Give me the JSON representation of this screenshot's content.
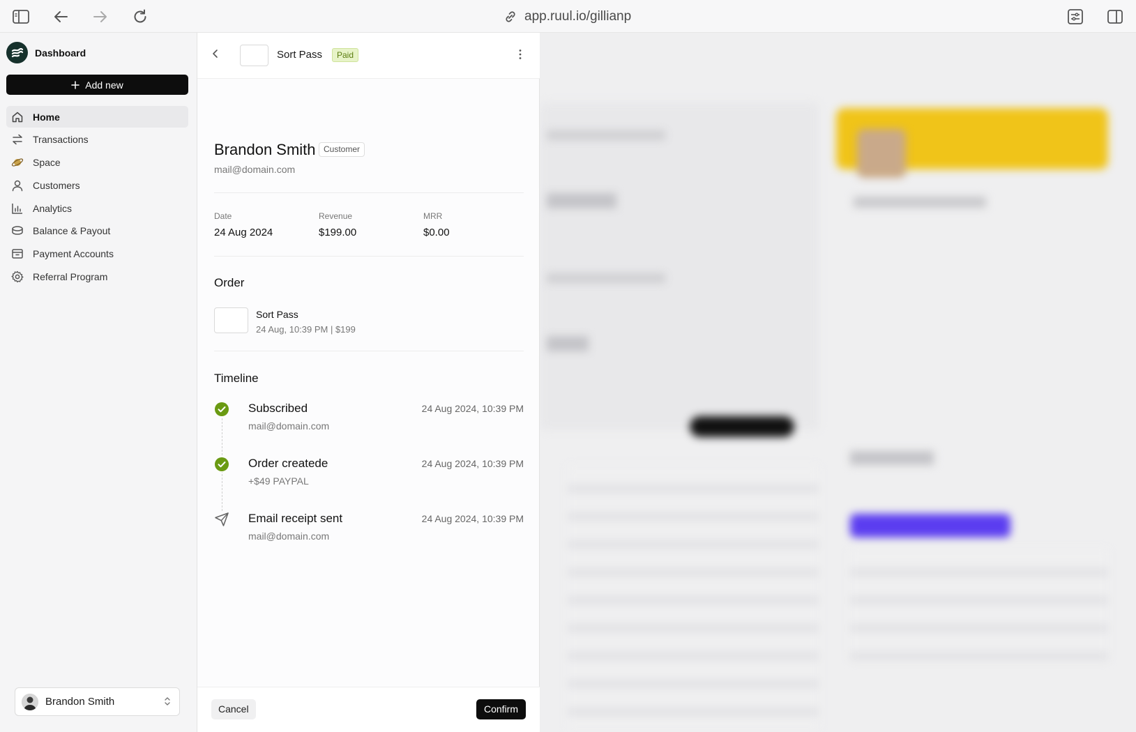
{
  "browser": {
    "url": "app.ruul.io/gillianp",
    "icons": [
      "sidebar-toggle-icon",
      "back-arrow-icon",
      "forward-arrow-icon",
      "reload-icon",
      "link-icon",
      "settings-sliders-icon",
      "split-view-icon"
    ]
  },
  "sidebar": {
    "brand": "Dashboard",
    "add_new": "Add new",
    "items": [
      {
        "label": "Home",
        "icon": "home-icon",
        "active": true
      },
      {
        "label": "Transactions",
        "icon": "arrows-swap-icon"
      },
      {
        "label": "Space",
        "icon": "planet-icon"
      },
      {
        "label": "Customers",
        "icon": "user-icon"
      },
      {
        "label": "Analytics",
        "icon": "bar-chart-icon"
      },
      {
        "label": "Balance & Payout",
        "icon": "coins-icon"
      },
      {
        "label": "Payment Accounts",
        "icon": "archive-icon"
      },
      {
        "label": "Referral Program",
        "icon": "gear-icon"
      }
    ],
    "user": "Brandon Smith"
  },
  "panel": {
    "product": "Sort Pass",
    "status": "Paid",
    "customer_name": "Brandon Smith",
    "customer_tag": "Customer",
    "customer_email": "mail@domain.com",
    "stats": [
      {
        "label": "Date",
        "value": "24 Aug 2024"
      },
      {
        "label": "Revenue",
        "value": "$199.00"
      },
      {
        "label": "MRR",
        "value": "$0.00"
      }
    ],
    "order_title": "Order",
    "order": {
      "name": "Sort Pass",
      "meta": "24 Aug, 10:39 PM | $199"
    },
    "timeline_title": "Timeline",
    "timeline": [
      {
        "title": "Subscribed",
        "sub": "mail@domain.com",
        "time": "24 Aug 2024, 10:39 PM",
        "icon": "check-circle-icon"
      },
      {
        "title": "Order createde",
        "sub": "+$49 PAYPAL",
        "time": "24 Aug 2024, 10:39 PM",
        "icon": "check-circle-icon"
      },
      {
        "title": "Email receipt sent",
        "sub": "mail@domain.com",
        "time": "24 Aug 2024, 10:39 PM",
        "icon": "send-icon"
      }
    ],
    "cancel": "Cancel",
    "confirm": "Confirm"
  },
  "colors": {
    "accent_green": "#6a9a12",
    "paid_bg": "#e7f3c8",
    "dark": "#0d0d0d",
    "banner_yellow": "#f0c419",
    "purple": "#5b3df0"
  }
}
